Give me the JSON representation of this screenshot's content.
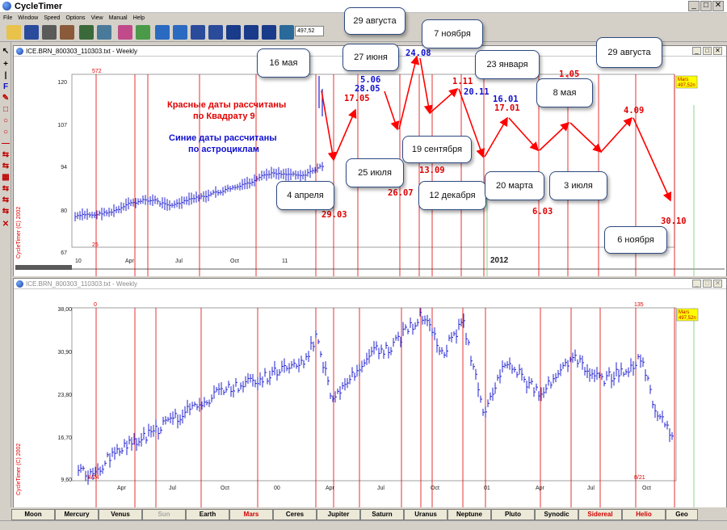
{
  "app": {
    "title": "CycleTimer"
  },
  "menu": [
    "File",
    "Window",
    "Speed",
    "Options",
    "View",
    "Manual",
    "Help"
  ],
  "toolbar": {
    "value": "497,52"
  },
  "left_tools": [
    "↖",
    "+",
    "|",
    "F",
    "✎",
    "□",
    "○",
    "○",
    "—",
    "⇆",
    "⇆",
    "▦",
    "⇆",
    "⇆",
    "⇆",
    "✕"
  ],
  "chart_top": {
    "window_title": "ICE.BRN_800303_110303.txt - Weekly",
    "y_ticks": [
      "120",
      "107",
      "94",
      "80",
      "67"
    ],
    "x_ticks": [
      "10",
      "Apr",
      "Jul",
      "Oct",
      "11",
      "2012"
    ],
    "marker_top": "572",
    "marker_bottom": "25",
    "copyright": "CycleTimer (C) 2002",
    "badge": [
      "Mars",
      "497,52n"
    ],
    "legend_red": [
      "Красные даты рассчитаны",
      "по Квадрату 9"
    ],
    "legend_blue": [
      "Синие даты рассчитаны",
      "по астроциклам"
    ]
  },
  "chart_bottom": {
    "window_title": "ICE.BRN_800303_110303.txt - Weekly",
    "y_ticks": [
      "38,00",
      "30,90",
      "23,80",
      "16,70",
      "9,60"
    ],
    "x_ticks": [
      "Apr",
      "Jul",
      "Oct",
      "00",
      "Apr",
      "Jul",
      "Oct",
      "01",
      "Apr",
      "Jul",
      "Oct"
    ],
    "marker_left": "0",
    "marker_right": "135",
    "label_bl": "8/24",
    "label_br": "8/21",
    "copyright": "CycleTimer (C) 2002",
    "badge": [
      "Mars",
      "497,52n"
    ]
  },
  "callouts": [
    {
      "id": "c1",
      "text": "16 мая"
    },
    {
      "id": "c2",
      "text": "27 июня"
    },
    {
      "id": "c3",
      "text": "29 августа"
    },
    {
      "id": "c4",
      "text": "7 ноября"
    },
    {
      "id": "c5",
      "text": "23 января"
    },
    {
      "id": "c6",
      "text": "29 августа"
    },
    {
      "id": "c7",
      "text": "8 мая"
    },
    {
      "id": "c8",
      "text": "4 апреля"
    },
    {
      "id": "c9",
      "text": "25 июля"
    },
    {
      "id": "c10",
      "text": "19 сентября"
    },
    {
      "id": "c11",
      "text": "12 декабря"
    },
    {
      "id": "c12",
      "text": "20 марта"
    },
    {
      "id": "c13",
      "text": "3 июля"
    },
    {
      "id": "c14",
      "text": "6 ноября"
    }
  ],
  "date_labels_red": [
    "17.05",
    "29.03",
    "26.07",
    "13.09",
    "1.11",
    "17.01",
    "6.03",
    "1.05",
    "4.09",
    "30.10"
  ],
  "date_labels_blue": [
    "5.06",
    "28.05",
    "24.08",
    "20.11",
    "16.01"
  ],
  "bottom_tabs": [
    {
      "label": "Moon",
      "style": "normal"
    },
    {
      "label": "Mercury",
      "style": "normal"
    },
    {
      "label": "Venus",
      "style": "normal"
    },
    {
      "label": "Sun",
      "style": "gray"
    },
    {
      "label": "Earth",
      "style": "normal"
    },
    {
      "label": "Mars",
      "style": "red"
    },
    {
      "label": "Ceres",
      "style": "normal"
    },
    {
      "label": "Jupiter",
      "style": "normal"
    },
    {
      "label": "Saturn",
      "style": "normal"
    },
    {
      "label": "Uranus",
      "style": "normal"
    },
    {
      "label": "Neptune",
      "style": "normal"
    },
    {
      "label": "Pluto",
      "style": "normal"
    },
    {
      "label": "Synodic",
      "style": "normal"
    },
    {
      "label": "Sidereal",
      "style": "red"
    },
    {
      "label": "Helio",
      "style": "red"
    },
    {
      "label": "Geo",
      "style": "normal"
    }
  ]
}
